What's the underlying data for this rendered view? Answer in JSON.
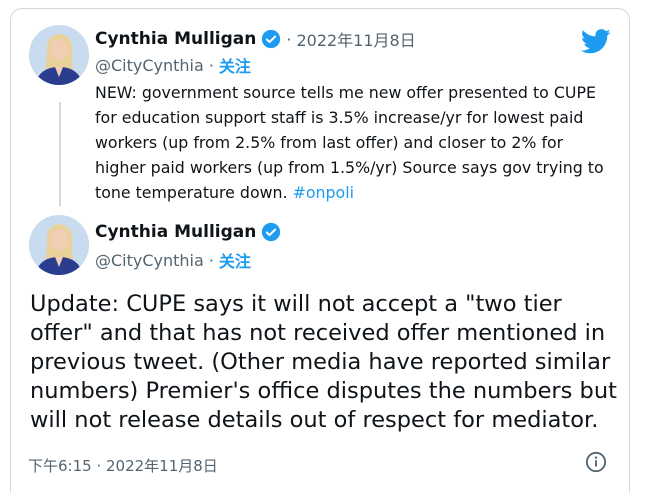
{
  "reply_tweet": {
    "author_name": "Cynthia Mulligan",
    "date_separator": "·",
    "date": "2022年11月8日",
    "handle": "@CityCynthia",
    "handle_separator": "·",
    "follow_label": "关注",
    "text_main": "NEW: government source tells me new offer presented to CUPE for education support staff is 3.5% increase/yr for lowest paid workers (up from 2.5% from last offer) and closer to 2% for higher paid workers (up from 1.5%/yr)  Source says gov trying to tone temperature down. ",
    "hashtag": "#onpoli"
  },
  "main_tweet": {
    "author_name": "Cynthia Mulligan",
    "handle": "@CityCynthia",
    "handle_separator": "·",
    "follow_label": "关注",
    "text": "Update: CUPE says it will not accept a \"two tier offer\" and that has not received offer mentioned in previous tweet.   (Other media have reported similar numbers) Premier's office disputes the numbers but will not release details out of respect for mediator.",
    "timestamp": "下午6:15 · 2022年11月8日"
  },
  "icons": {
    "logo": "twitter-bird-icon",
    "verified": "verified-badge-icon",
    "info": "info-icon"
  },
  "colors": {
    "accent": "#1d9bf0",
    "text": "#0f1419",
    "secondary": "#536471",
    "border": "#cfd9de"
  }
}
